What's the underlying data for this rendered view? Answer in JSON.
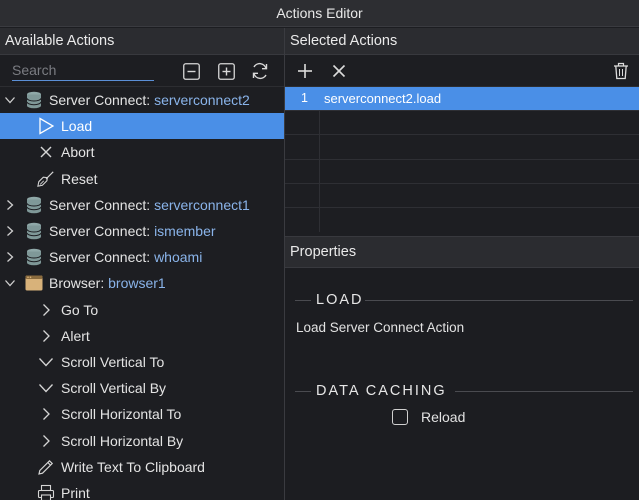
{
  "window": {
    "title": "Actions Editor"
  },
  "left_panel": {
    "title": "Available Actions",
    "search_placeholder": "Search",
    "items": [
      {
        "prefix": "Server Connect: ",
        "name": "serverconnect2",
        "expanded": true
      },
      {
        "label": "Load"
      },
      {
        "label": "Abort"
      },
      {
        "label": "Reset"
      },
      {
        "prefix": "Server Connect: ",
        "name": "serverconnect1"
      },
      {
        "prefix": "Server Connect: ",
        "name": "ismember"
      },
      {
        "prefix": "Server Connect: ",
        "name": "whoami"
      },
      {
        "prefix": "Browser: ",
        "name": "browser1",
        "expanded": true
      },
      {
        "label": "Go To"
      },
      {
        "label": "Alert"
      },
      {
        "label": "Scroll Vertical To"
      },
      {
        "label": "Scroll Vertical By"
      },
      {
        "label": "Scroll Horizontal To"
      },
      {
        "label": "Scroll Horizontal By"
      },
      {
        "label": "Write Text To Clipboard"
      },
      {
        "label": "Print"
      }
    ]
  },
  "right_panel": {
    "title": "Selected Actions",
    "rows": [
      {
        "num": "1",
        "value": "serverconnect2.load"
      }
    ]
  },
  "properties": {
    "title": "Properties",
    "section_load": "LOAD",
    "description": "Load Server Connect Action",
    "section_caching": "DATA CACHING",
    "reload_label": "Reload",
    "reload_checked": false
  },
  "colors": {
    "selection": "#4a8fe7",
    "accent_text": "#8ab4ea",
    "background": "#1d1e22"
  }
}
